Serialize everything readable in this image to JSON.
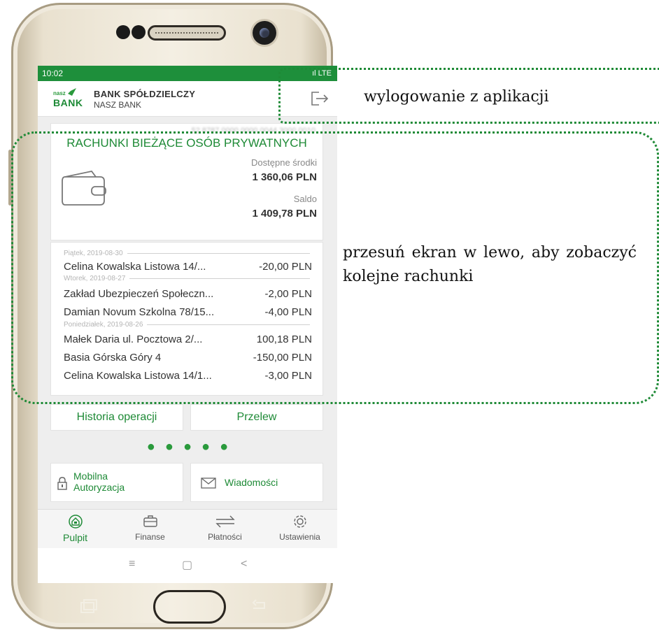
{
  "status_bar": {
    "time": "10:02",
    "signal": "ıl LTE"
  },
  "header": {
    "logo_small": "nasz",
    "logo_big": "BANK",
    "bank_name": "BANK SPÓŁDZIELCZY",
    "bank_subtitle": "NASZ BANK",
    "logout_icon": "logout-icon"
  },
  "account": {
    "number": "52 8787 0000 0000 0044 3000 0010",
    "title": "RACHUNKI BIEŻĄCE OSÓB PRYWATNYCH",
    "available_label": "Dostępne środki",
    "available_value": "1 360,06 PLN",
    "balance_label": "Saldo",
    "balance_value": "1 409,78 PLN"
  },
  "transactions": {
    "dates": [
      "Piątek, 2019-08-30",
      "Wtorek, 2019-08-27",
      "Poniedziałek, 2019-08-26"
    ],
    "items": [
      {
        "name": "Celina Kowalska Listowa 14/...",
        "amount": "-20,00 PLN"
      },
      {
        "name": "Zakład Ubezpieczeń Społeczn...",
        "amount": "-2,00 PLN"
      },
      {
        "name": "Damian Novum Szkolna 78/15...",
        "amount": "-4,00 PLN"
      },
      {
        "name": "Małek Daria ul. Pocztowa 2/...",
        "amount": "100,18 PLN"
      },
      {
        "name": "Basia Górska Góry 4",
        "amount": "-150,00 PLN"
      },
      {
        "name": "Celina Kowalska Listowa 14/1...",
        "amount": "-3,00 PLN"
      }
    ]
  },
  "buttons": {
    "history": "Historia operacji",
    "transfer": "Przelew"
  },
  "tiles": {
    "mobile_auth_line1": "Mobilna",
    "mobile_auth_line2": "Autoryzacja",
    "messages": "Wiadomości"
  },
  "bottom_nav": [
    {
      "label": "Pulpit",
      "icon": "home-icon",
      "active": true
    },
    {
      "label": "Finanse",
      "icon": "briefcase-icon",
      "active": false
    },
    {
      "label": "Płatności",
      "icon": "transfer-arrows-icon",
      "active": false
    },
    {
      "label": "Ustawienia",
      "icon": "gear-icon",
      "active": false
    }
  ],
  "system_nav": {
    "recent": "≡",
    "home": "▢",
    "back": "<"
  },
  "annotations": {
    "logout": "wylogowanie z aplikacji",
    "swipe": "przesuń ekran w lewo, aby zobaczyć kolejne rachunki"
  },
  "colors": {
    "brand_green": "#1e8a36",
    "status_bar": "#1e8f3b"
  }
}
